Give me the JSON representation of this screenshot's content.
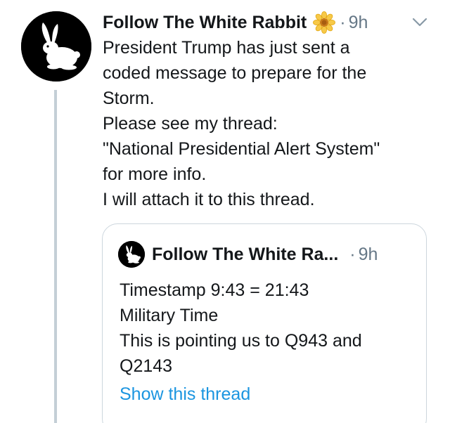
{
  "tweet": {
    "author_name": "Follow The White Rabbit",
    "badge_icon": "sunflower-icon",
    "separator": "·",
    "time": "9h",
    "menu_icon": "chevron-down-icon",
    "body_lines": [
      "President Trump has just sent a",
      "coded message to prepare for the",
      "Storm.",
      "Please see my thread:",
      "\"National Presidential Alert System\"",
      "for more info.",
      "I will attach it to this thread."
    ]
  },
  "quoted_tweet": {
    "author_name": "Follow The White Ra...",
    "separator": "·",
    "time": "9h",
    "body_lines": [
      "Timestamp 9:43 = 21:43",
      "Military Time",
      "This is pointing us to Q943 and",
      "Q2143"
    ],
    "show_thread_label": "Show this thread"
  },
  "colors": {
    "text": "#14171a",
    "secondary": "#657786",
    "link": "#1b95e0",
    "border": "#ccd6dd",
    "thread_line": "#c4cfd6"
  }
}
